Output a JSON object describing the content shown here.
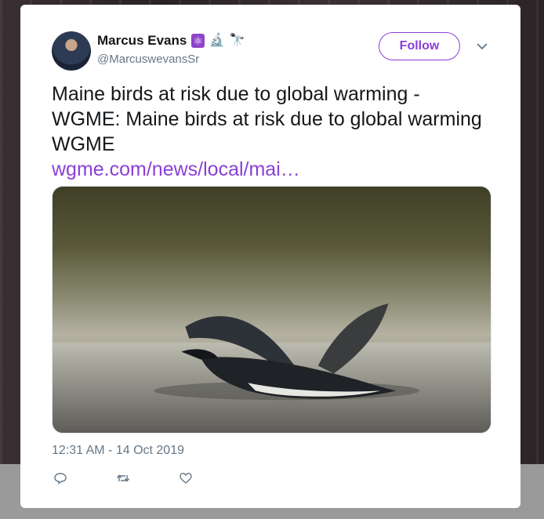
{
  "tweet": {
    "author_name": "Marcus Evans",
    "author_handle": "@MarcuswevansSr",
    "author_emojis": [
      "⚛",
      "🔬",
      "🔭"
    ],
    "follow_label": "Follow",
    "text": "Maine birds at risk due to global warming - WGME: Maine birds at risk due to global warming  WGME",
    "link_text": "wgme.com/news/local/mai…",
    "timestamp": "12:31 AM - 14 Oct 2019",
    "accent_color": "#8a3fd6"
  },
  "actions": {
    "reply_icon": "reply-icon",
    "retweet_icon": "retweet-icon",
    "like_icon": "heart-icon"
  }
}
